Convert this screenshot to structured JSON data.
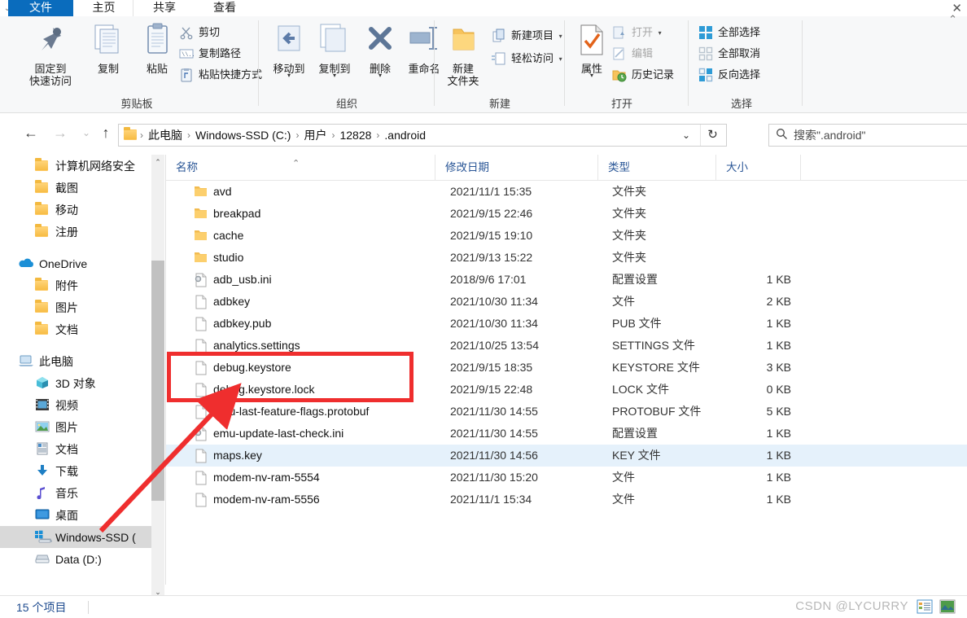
{
  "window": {
    "close_glyph": "✕",
    "collapse_ribbon_glyph": "⌃",
    "left_chevron_glyph": "⌄"
  },
  "tabs": [
    {
      "label": "文件",
      "name": "tab-file",
      "active": true
    },
    {
      "label": "主页",
      "name": "tab-home",
      "active": false
    },
    {
      "label": "共享",
      "name": "tab-share",
      "active": false
    },
    {
      "label": "查看",
      "name": "tab-view",
      "active": false
    }
  ],
  "ribbon": {
    "groups": [
      {
        "label": "剪贴板",
        "name": "ribbon-group-clipboard"
      },
      {
        "label": "组织",
        "name": "ribbon-group-organize"
      },
      {
        "label": "新建",
        "name": "ribbon-group-new"
      },
      {
        "label": "打开",
        "name": "ribbon-group-open"
      },
      {
        "label": "选择",
        "name": "ribbon-group-select"
      }
    ],
    "clipboard": {
      "pin_line1": "固定到",
      "pin_line2": "快速访问",
      "copy": "复制",
      "paste": "粘贴",
      "cut": "剪切",
      "copy_path": "复制路径",
      "paste_shortcut": "粘贴快捷方式"
    },
    "organize": {
      "move_to": "移动到",
      "copy_to": "复制到",
      "delete": "删除",
      "rename": "重命名"
    },
    "new": {
      "new_folder_line1": "新建",
      "new_folder_line2": "文件夹",
      "new_item": "新建项目",
      "easy_access": "轻松访问"
    },
    "open": {
      "properties": "属性",
      "open": "打开",
      "edit": "编辑",
      "history": "历史记录"
    },
    "select": {
      "select_all": "全部选择",
      "select_none": "全部取消",
      "invert": "反向选择"
    }
  },
  "nav": {
    "back_glyph": "←",
    "forward_glyph": "→",
    "recent_glyph": "⌄",
    "up_glyph": "↑",
    "breadcrumbs": [
      "此电脑",
      "Windows-SSD (C:)",
      "用户",
      "12828",
      ".android"
    ],
    "separator": "›",
    "dropdown_glyph": "⌄",
    "refresh_glyph": "↻"
  },
  "search": {
    "icon": "search-icon",
    "placeholder": "搜索\".android\""
  },
  "sidebar": {
    "items": [
      {
        "label": "计算机网络安全",
        "icon": "folder-icon",
        "indent": 1,
        "selected": false
      },
      {
        "label": "截图",
        "icon": "folder-icon",
        "indent": 1,
        "selected": false
      },
      {
        "label": "移动",
        "icon": "folder-icon",
        "indent": 1,
        "selected": false
      },
      {
        "label": "注册",
        "icon": "folder-icon",
        "indent": 1,
        "selected": false
      },
      {
        "label": "OneDrive",
        "icon": "onedrive-icon",
        "indent": 0,
        "selected": false
      },
      {
        "label": "附件",
        "icon": "folder-icon",
        "indent": 1,
        "selected": false
      },
      {
        "label": "图片",
        "icon": "folder-icon",
        "indent": 1,
        "selected": false
      },
      {
        "label": "文档",
        "icon": "folder-icon",
        "indent": 1,
        "selected": false
      },
      {
        "label": "此电脑",
        "icon": "this-pc-icon",
        "indent": 0,
        "selected": false
      },
      {
        "label": "3D 对象",
        "icon": "3d-objects-icon",
        "indent": 1,
        "selected": false
      },
      {
        "label": "视频",
        "icon": "videos-icon",
        "indent": 1,
        "selected": false
      },
      {
        "label": "图片",
        "icon": "pictures-icon",
        "indent": 1,
        "selected": false
      },
      {
        "label": "文档",
        "icon": "documents-icon",
        "indent": 1,
        "selected": false
      },
      {
        "label": "下载",
        "icon": "downloads-icon",
        "indent": 1,
        "selected": false
      },
      {
        "label": "音乐",
        "icon": "music-icon",
        "indent": 1,
        "selected": false
      },
      {
        "label": "桌面",
        "icon": "desktop-icon",
        "indent": 1,
        "selected": false
      },
      {
        "label": "Windows-SSD (",
        "icon": "drive-windows-icon",
        "indent": 1,
        "selected": true
      },
      {
        "label": "Data (D:)",
        "icon": "drive-icon",
        "indent": 1,
        "selected": false
      }
    ],
    "scroll_up_glyph": "⌃",
    "scroll_down_glyph": "⌄"
  },
  "columns": [
    {
      "label": "名称",
      "name": "column-name"
    },
    {
      "label": "修改日期",
      "name": "column-date-modified"
    },
    {
      "label": "类型",
      "name": "column-type"
    },
    {
      "label": "大小",
      "name": "column-size"
    }
  ],
  "sort_indicator": "⌃",
  "files": [
    {
      "name": "avd",
      "date": "2021/11/1 15:35",
      "type": "文件夹",
      "size": "",
      "icon": "folder-icon",
      "selected": false
    },
    {
      "name": "breakpad",
      "date": "2021/9/15 22:46",
      "type": "文件夹",
      "size": "",
      "icon": "folder-icon",
      "selected": false
    },
    {
      "name": "cache",
      "date": "2021/9/15 19:10",
      "type": "文件夹",
      "size": "",
      "icon": "folder-icon",
      "selected": false
    },
    {
      "name": "studio",
      "date": "2021/9/13 15:22",
      "type": "文件夹",
      "size": "",
      "icon": "folder-icon",
      "selected": false
    },
    {
      "name": "adb_usb.ini",
      "date": "2018/9/6 17:01",
      "type": "配置设置",
      "size": "1 KB",
      "icon": "ini-icon",
      "selected": false
    },
    {
      "name": "adbkey",
      "date": "2021/10/30 11:34",
      "type": "文件",
      "size": "2 KB",
      "icon": "file-icon",
      "selected": false
    },
    {
      "name": "adbkey.pub",
      "date": "2021/10/30 11:34",
      "type": "PUB 文件",
      "size": "1 KB",
      "icon": "file-icon",
      "selected": false
    },
    {
      "name": "analytics.settings",
      "date": "2021/10/25 13:54",
      "type": "SETTINGS 文件",
      "size": "1 KB",
      "icon": "file-icon",
      "selected": false
    },
    {
      "name": "debug.keystore",
      "date": "2021/9/15 18:35",
      "type": "KEYSTORE 文件",
      "size": "3 KB",
      "icon": "file-icon",
      "selected": false
    },
    {
      "name": "debug.keystore.lock",
      "date": "2021/9/15 22:48",
      "type": "LOCK 文件",
      "size": "0 KB",
      "icon": "file-icon",
      "selected": false
    },
    {
      "name": "emu-last-feature-flags.protobuf",
      "date": "2021/11/30 14:55",
      "type": "PROTOBUF 文件",
      "size": "5 KB",
      "icon": "file-icon",
      "selected": false
    },
    {
      "name": "emu-update-last-check.ini",
      "date": "2021/11/30 14:55",
      "type": "配置设置",
      "size": "1 KB",
      "icon": "ini-icon",
      "selected": false
    },
    {
      "name": "maps.key",
      "date": "2021/11/30 14:56",
      "type": "KEY 文件",
      "size": "1 KB",
      "icon": "file-icon",
      "selected": true
    },
    {
      "name": "modem-nv-ram-5554",
      "date": "2021/11/30 15:20",
      "type": "文件",
      "size": "1 KB",
      "icon": "file-icon",
      "selected": false
    },
    {
      "name": "modem-nv-ram-5556",
      "date": "2021/11/1 15:34",
      "type": "文件",
      "size": "1 KB",
      "icon": "file-icon",
      "selected": false
    }
  ],
  "status": {
    "item_count": "15 个项目",
    "view_details_icon": "details-view-icon",
    "view_large_icons_icon": "large-icons-view-icon"
  },
  "watermark": "CSDN @LYCURRY",
  "annotation": {
    "highlight_color": "#ef2e2e",
    "arrow_color": "#ef2e2e",
    "highlighted_file": "debug.keystore"
  }
}
